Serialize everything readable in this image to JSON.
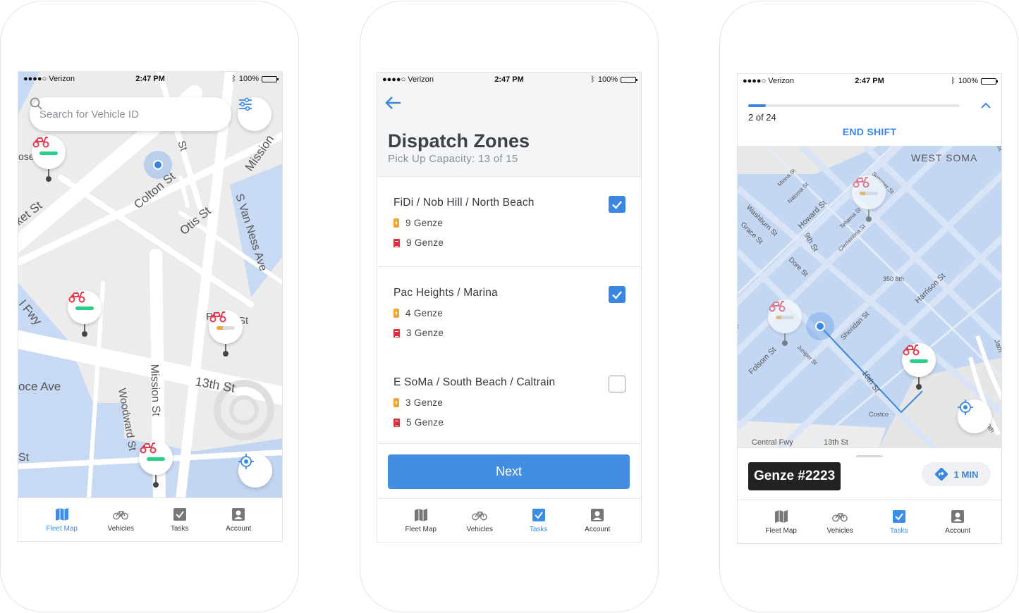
{
  "status": {
    "carrier": "●●●●○ Verizon",
    "time": "2:47 PM",
    "battery": "100%"
  },
  "screen1": {
    "search_placeholder": "Search for Vehicle ID",
    "streets": [
      "rket St",
      "Colton St",
      "Otis St",
      "Mission",
      "S Van Ness Ave",
      "l Fwy",
      "13th St",
      "Mission St",
      "Woodward St",
      "oce Ave",
      "St",
      "St",
      "Pl",
      "St",
      "ose"
    ]
  },
  "screen2": {
    "title": "Dispatch Zones",
    "subtitle": "Pick Up Capacity: 13 of 15",
    "zones": [
      {
        "name": "FiDi / Nob Hill / North Beach",
        "charge": "9 Genze",
        "repair": "9 Genze",
        "checked": true
      },
      {
        "name": "Pac Heights / Marina",
        "charge": "4 Genze",
        "repair": "3 Genze",
        "checked": true
      },
      {
        "name": "E SoMa / South Beach / Caltrain",
        "charge": "3 Genze",
        "repair": "5 Genze",
        "checked": false
      }
    ],
    "next_label": "Next"
  },
  "screen3": {
    "progress": {
      "current": 2,
      "total": 24,
      "label": "2 of 24"
    },
    "end_shift": "END SHIFT",
    "vehicle": "Genze #2223",
    "eta": "1 MIN",
    "streets": [
      "WEST SOMA",
      "Minna St",
      "Natoma St",
      "Howard St",
      "Summer St",
      "Washburn St",
      "Grace St",
      "9th St",
      "Tehama St",
      "Clementina St",
      "Dore St",
      "350 8th",
      "Harrison St",
      "Sheridan St",
      "Folsom St",
      "Juniper St",
      "10th St",
      "Costco",
      "Central Fwy",
      "13th St",
      "St",
      "Jam",
      "9th",
      "St"
    ]
  },
  "tabs": [
    {
      "label": "Fleet Map",
      "icon": "map-icon"
    },
    {
      "label": "Vehicles",
      "icon": "bicycle-icon"
    },
    {
      "label": "Tasks",
      "icon": "checkbox-icon"
    },
    {
      "label": "Account",
      "icon": "account-icon"
    }
  ],
  "colors": {
    "accent": "#3a86e0",
    "map_water": "#c7d9f3",
    "scooter": "#e53a4d",
    "battery_full": "#2bcf8a",
    "battery_low": "#f2a52e"
  }
}
